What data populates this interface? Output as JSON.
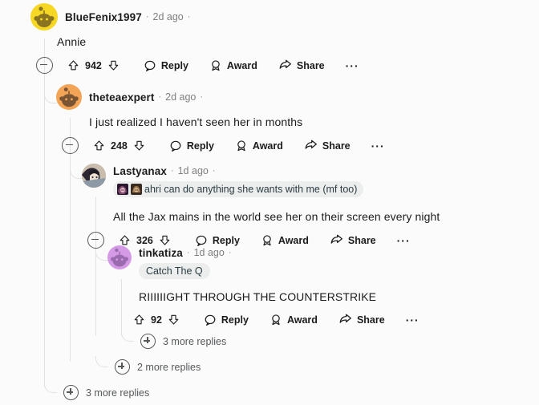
{
  "thread": {
    "comments": [
      {
        "id": "c1",
        "username": "BlueFenix1997",
        "timestamp": "2d ago",
        "separator": "·",
        "body": "Annie",
        "score": "942",
        "avatar_color": "#f5d724",
        "avatar_type": "snoo",
        "actions": {
          "upvote": "upvote-icon",
          "downvote": "downvote-icon",
          "reply": "Reply",
          "award": "Award",
          "share": "Share",
          "overflow": "···"
        },
        "has_collapse": true,
        "flair": null
      },
      {
        "id": "c2",
        "username": "theteaexpert",
        "timestamp": "2d ago",
        "separator": "·",
        "body": "I just realized I haven't seen her in months",
        "score": "248",
        "avatar_color": "#f3a457",
        "avatar_type": "snoo",
        "actions": {
          "upvote": "upvote-icon",
          "downvote": "downvote-icon",
          "reply": "Reply",
          "award": "Award",
          "share": "Share",
          "overflow": "···"
        },
        "has_collapse": true,
        "flair": null
      },
      {
        "id": "c3",
        "username": "Lastyanax",
        "timestamp": "1d ago",
        "separator": "·",
        "body": "All the Jax mains in the world see her on their screen every night",
        "score": "326",
        "avatar_color": "#6f6357",
        "avatar_type": "photo",
        "actions": {
          "upvote": "upvote-icon",
          "downvote": "downvote-icon",
          "reply": "Reply",
          "award": "Award",
          "share": "Share",
          "overflow": "···"
        },
        "has_collapse": true,
        "flair": {
          "text": "ahri can do anything she wants with me (mf too)",
          "emojis": [
            "flair-emoji-ahri",
            "flair-emoji-champion"
          ]
        }
      },
      {
        "id": "c4",
        "username": "tinkatiza",
        "timestamp": "1d ago",
        "separator": "·",
        "body": "RIIIIIIGHT THROUGH THE COUNTERSTRIKE",
        "score": "92",
        "avatar_color": "#d59ae6",
        "avatar_type": "snoo",
        "actions": {
          "upvote": "upvote-icon",
          "downvote": "downvote-icon",
          "reply": "Reply",
          "award": "Award",
          "share": "Share",
          "overflow": "···"
        },
        "has_collapse": false,
        "flair": {
          "text": "Catch The Q",
          "emojis": []
        }
      }
    ],
    "more_replies": [
      {
        "id": "m1",
        "label": "3 more replies",
        "icon": "plus-icon"
      },
      {
        "id": "m2",
        "label": "2 more replies",
        "icon": "plus-icon"
      },
      {
        "id": "m3",
        "label": "3 more replies",
        "icon": "plus-icon"
      }
    ],
    "colors": {
      "background": "#fbfbfb",
      "text": "#1b1b1b",
      "muted": "#7d7f80",
      "thread_line": "#e1e2e3",
      "flair_bg": "#eceded"
    }
  }
}
